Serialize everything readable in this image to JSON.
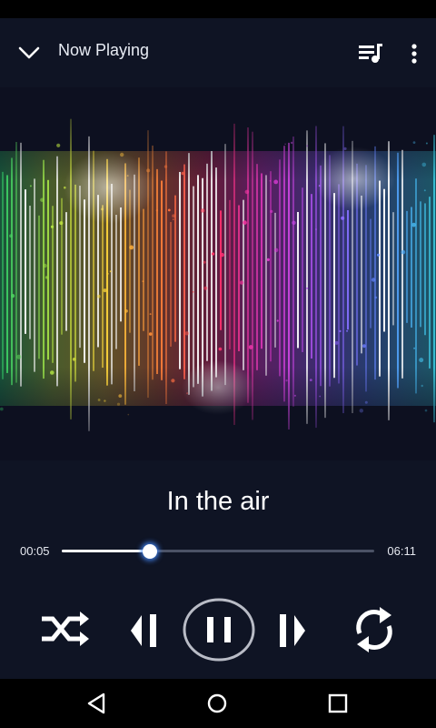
{
  "app_bar": {
    "title": "Now Playing",
    "icons": [
      "chevron-down-icon",
      "queue-music-icon",
      "more-vert-icon"
    ]
  },
  "track": {
    "title": "In the air",
    "elapsed": "00:05",
    "duration": "06:11",
    "progress": 0.283
  },
  "controls": [
    "shuffle-icon",
    "previous-icon",
    "pause-icon",
    "next-icon",
    "repeat-icon"
  ],
  "nav_bar": [
    "nav-back-icon",
    "nav-home-icon",
    "nav-recents-icon"
  ],
  "colors": {
    "background": "#0f1424",
    "accent_glow": "#468cff",
    "text": "#ffffff"
  }
}
